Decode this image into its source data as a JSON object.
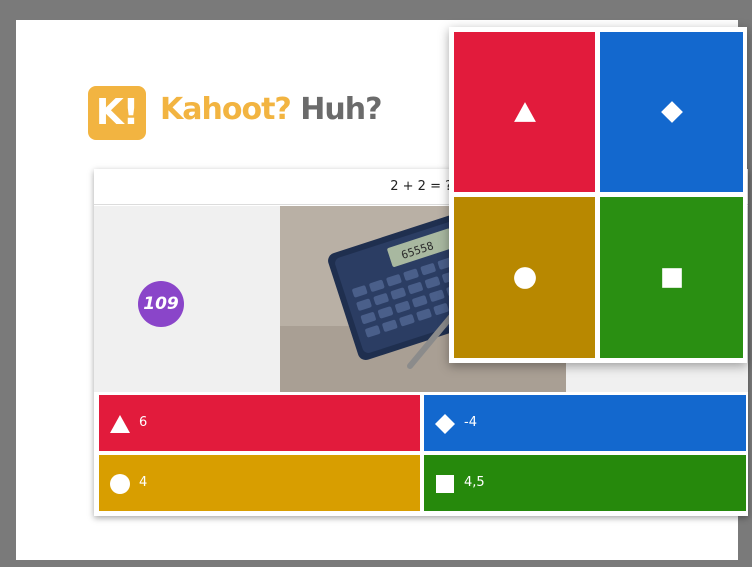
{
  "logo": {
    "mark": "K!",
    "title_part1": "Kahoot?",
    "title_part2": "Huh?"
  },
  "question": {
    "text": "2 + 2 = ?"
  },
  "timer": {
    "value": "109"
  },
  "answers": [
    {
      "shape": "triangle-icon",
      "label": "6",
      "color": "#e21b3c"
    },
    {
      "shape": "diamond-icon",
      "label": "-4",
      "color": "#1368ce"
    },
    {
      "shape": "circle-icon",
      "label": "4",
      "color": "#d89e00"
    },
    {
      "shape": "square-icon",
      "label": "4,5",
      "color": "#26890c"
    }
  ],
  "overlay_tiles": [
    {
      "shape": "triangle-icon",
      "color": "#e21b3c"
    },
    {
      "shape": "diamond-icon",
      "color": "#1368ce"
    },
    {
      "shape": "circle-icon",
      "color": "#b88800"
    },
    {
      "shape": "square-icon",
      "color": "#2a8f12"
    }
  ],
  "colors": {
    "logo": "#f2b441",
    "timer": "#8a45c9",
    "frame": "#7a7a7a"
  }
}
